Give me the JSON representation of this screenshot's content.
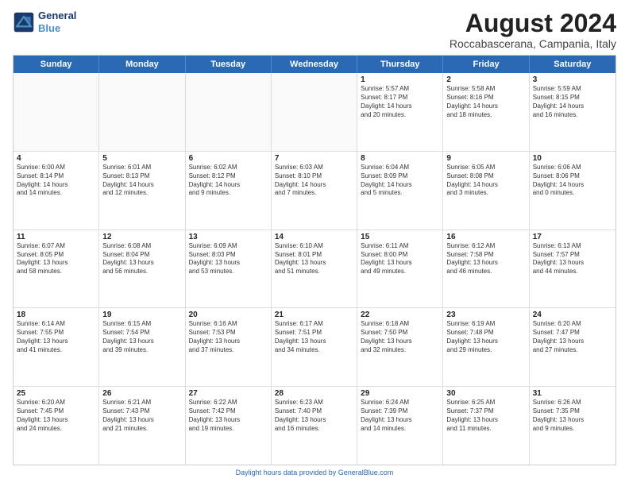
{
  "logo": {
    "line1": "General",
    "line2": "Blue"
  },
  "title": "August 2024",
  "subtitle": "Roccabascerana, Campania, Italy",
  "days_of_week": [
    "Sunday",
    "Monday",
    "Tuesday",
    "Wednesday",
    "Thursday",
    "Friday",
    "Saturday"
  ],
  "footer": "Daylight hours",
  "weeks": [
    [
      {
        "day": "",
        "info": ""
      },
      {
        "day": "",
        "info": ""
      },
      {
        "day": "",
        "info": ""
      },
      {
        "day": "",
        "info": ""
      },
      {
        "day": "1",
        "info": "Sunrise: 5:57 AM\nSunset: 8:17 PM\nDaylight: 14 hours\nand 20 minutes."
      },
      {
        "day": "2",
        "info": "Sunrise: 5:58 AM\nSunset: 8:16 PM\nDaylight: 14 hours\nand 18 minutes."
      },
      {
        "day": "3",
        "info": "Sunrise: 5:59 AM\nSunset: 8:15 PM\nDaylight: 14 hours\nand 16 minutes."
      }
    ],
    [
      {
        "day": "4",
        "info": "Sunrise: 6:00 AM\nSunset: 8:14 PM\nDaylight: 14 hours\nand 14 minutes."
      },
      {
        "day": "5",
        "info": "Sunrise: 6:01 AM\nSunset: 8:13 PM\nDaylight: 14 hours\nand 12 minutes."
      },
      {
        "day": "6",
        "info": "Sunrise: 6:02 AM\nSunset: 8:12 PM\nDaylight: 14 hours\nand 9 minutes."
      },
      {
        "day": "7",
        "info": "Sunrise: 6:03 AM\nSunset: 8:10 PM\nDaylight: 14 hours\nand 7 minutes."
      },
      {
        "day": "8",
        "info": "Sunrise: 6:04 AM\nSunset: 8:09 PM\nDaylight: 14 hours\nand 5 minutes."
      },
      {
        "day": "9",
        "info": "Sunrise: 6:05 AM\nSunset: 8:08 PM\nDaylight: 14 hours\nand 3 minutes."
      },
      {
        "day": "10",
        "info": "Sunrise: 6:06 AM\nSunset: 8:06 PM\nDaylight: 14 hours\nand 0 minutes."
      }
    ],
    [
      {
        "day": "11",
        "info": "Sunrise: 6:07 AM\nSunset: 8:05 PM\nDaylight: 13 hours\nand 58 minutes."
      },
      {
        "day": "12",
        "info": "Sunrise: 6:08 AM\nSunset: 8:04 PM\nDaylight: 13 hours\nand 56 minutes."
      },
      {
        "day": "13",
        "info": "Sunrise: 6:09 AM\nSunset: 8:03 PM\nDaylight: 13 hours\nand 53 minutes."
      },
      {
        "day": "14",
        "info": "Sunrise: 6:10 AM\nSunset: 8:01 PM\nDaylight: 13 hours\nand 51 minutes."
      },
      {
        "day": "15",
        "info": "Sunrise: 6:11 AM\nSunset: 8:00 PM\nDaylight: 13 hours\nand 49 minutes."
      },
      {
        "day": "16",
        "info": "Sunrise: 6:12 AM\nSunset: 7:58 PM\nDaylight: 13 hours\nand 46 minutes."
      },
      {
        "day": "17",
        "info": "Sunrise: 6:13 AM\nSunset: 7:57 PM\nDaylight: 13 hours\nand 44 minutes."
      }
    ],
    [
      {
        "day": "18",
        "info": "Sunrise: 6:14 AM\nSunset: 7:55 PM\nDaylight: 13 hours\nand 41 minutes."
      },
      {
        "day": "19",
        "info": "Sunrise: 6:15 AM\nSunset: 7:54 PM\nDaylight: 13 hours\nand 39 minutes."
      },
      {
        "day": "20",
        "info": "Sunrise: 6:16 AM\nSunset: 7:53 PM\nDaylight: 13 hours\nand 37 minutes."
      },
      {
        "day": "21",
        "info": "Sunrise: 6:17 AM\nSunset: 7:51 PM\nDaylight: 13 hours\nand 34 minutes."
      },
      {
        "day": "22",
        "info": "Sunrise: 6:18 AM\nSunset: 7:50 PM\nDaylight: 13 hours\nand 32 minutes."
      },
      {
        "day": "23",
        "info": "Sunrise: 6:19 AM\nSunset: 7:48 PM\nDaylight: 13 hours\nand 29 minutes."
      },
      {
        "day": "24",
        "info": "Sunrise: 6:20 AM\nSunset: 7:47 PM\nDaylight: 13 hours\nand 27 minutes."
      }
    ],
    [
      {
        "day": "25",
        "info": "Sunrise: 6:20 AM\nSunset: 7:45 PM\nDaylight: 13 hours\nand 24 minutes."
      },
      {
        "day": "26",
        "info": "Sunrise: 6:21 AM\nSunset: 7:43 PM\nDaylight: 13 hours\nand 21 minutes."
      },
      {
        "day": "27",
        "info": "Sunrise: 6:22 AM\nSunset: 7:42 PM\nDaylight: 13 hours\nand 19 minutes."
      },
      {
        "day": "28",
        "info": "Sunrise: 6:23 AM\nSunset: 7:40 PM\nDaylight: 13 hours\nand 16 minutes."
      },
      {
        "day": "29",
        "info": "Sunrise: 6:24 AM\nSunset: 7:39 PM\nDaylight: 13 hours\nand 14 minutes."
      },
      {
        "day": "30",
        "info": "Sunrise: 6:25 AM\nSunset: 7:37 PM\nDaylight: 13 hours\nand 11 minutes."
      },
      {
        "day": "31",
        "info": "Sunrise: 6:26 AM\nSunset: 7:35 PM\nDaylight: 13 hours\nand 9 minutes."
      }
    ]
  ]
}
